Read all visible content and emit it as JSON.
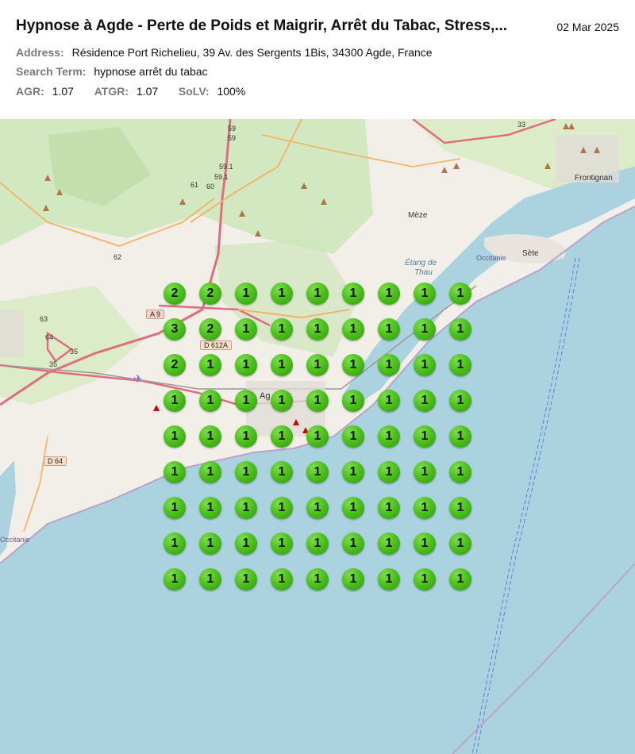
{
  "header": {
    "title": "Hypnose à Agde - Perte de Poids et Maigrir, Arrêt du Tabac, Stress,...",
    "date": "02 Mar 2025",
    "address_label": "Address:",
    "address": "Résidence Port Richelieu, 39 Av. des Sergents 1Bis, 34300 Agde, France",
    "search_label": "Search Term:",
    "search_term": "hypnose arrêt du tabac",
    "agr_label": "AGR:",
    "agr": "1.07",
    "atgr_label": "ATGR:",
    "atgr": "1.07",
    "solv_label": "SoLV:",
    "solv": "100%"
  },
  "map": {
    "labels": {
      "meze": "Mèze",
      "sete": "Sète",
      "frontignan": "Frontignan",
      "etang": "Étang de",
      "thau": "Thau",
      "occitanie": "Occitanie",
      "occitanie2": "Occitanie",
      "agde": "Ag",
      "road_a9": "A 9",
      "road_d612a": "D 612A",
      "road_d64": "D 64",
      "n59a": "59",
      "n59b": "59",
      "n591a": "59.1",
      "n591b": "59.1",
      "n61": "61",
      "n60": "60",
      "n62": "62",
      "n63": "63",
      "n64": "64",
      "n35a": "35",
      "n35b": "35",
      "n33": "33"
    },
    "colors": {
      "sea": "#aad3df",
      "land": "#f2efe9",
      "forest": "#cde6b9",
      "road": "#e06c80",
      "pin": "#4cc21c"
    },
    "grid": [
      [
        2,
        2,
        1,
        1,
        1,
        1,
        1,
        1,
        1
      ],
      [
        3,
        2,
        1,
        1,
        1,
        1,
        1,
        1,
        1
      ],
      [
        2,
        1,
        1,
        1,
        1,
        1,
        1,
        1,
        1
      ],
      [
        1,
        1,
        1,
        1,
        1,
        1,
        1,
        1,
        1
      ],
      [
        1,
        1,
        1,
        1,
        1,
        1,
        1,
        1,
        1
      ],
      [
        1,
        1,
        1,
        1,
        1,
        1,
        1,
        1,
        1
      ],
      [
        1,
        1,
        1,
        1,
        1,
        1,
        1,
        1,
        1
      ],
      [
        1,
        1,
        1,
        1,
        1,
        1,
        1,
        1,
        1
      ],
      [
        1,
        1,
        1,
        1,
        1,
        1,
        1,
        1,
        1
      ]
    ]
  }
}
